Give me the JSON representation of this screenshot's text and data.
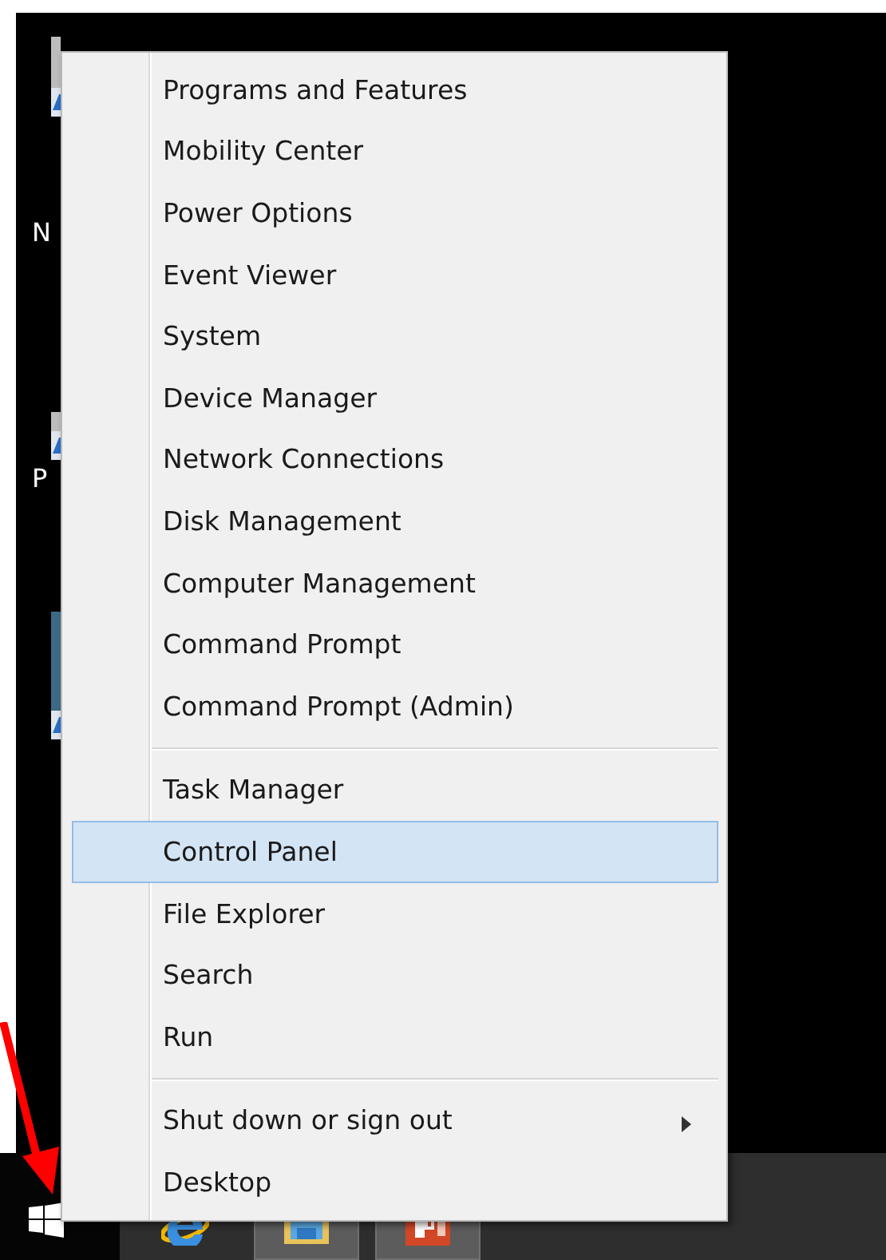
{
  "desktop_icons": [
    {
      "kind": "file"
    },
    {
      "label": "N"
    },
    {
      "kind": "file",
      "label": "P"
    },
    {
      "kind": "file"
    }
  ],
  "menu": {
    "groups": [
      [
        {
          "label": "Programs and Features",
          "selected": false
        },
        {
          "label": "Mobility Center",
          "selected": false
        },
        {
          "label": "Power Options",
          "selected": false
        },
        {
          "label": "Event Viewer",
          "selected": false
        },
        {
          "label": "System",
          "selected": false
        },
        {
          "label": "Device Manager",
          "selected": false
        },
        {
          "label": "Network Connections",
          "selected": false
        },
        {
          "label": "Disk Management",
          "selected": false
        },
        {
          "label": "Computer Management",
          "selected": false
        },
        {
          "label": "Command Prompt",
          "selected": false
        },
        {
          "label": "Command Prompt (Admin)",
          "selected": false
        }
      ],
      [
        {
          "label": "Task Manager",
          "selected": false
        },
        {
          "label": "Control Panel",
          "selected": true
        },
        {
          "label": "File Explorer",
          "selected": false
        },
        {
          "label": "Search",
          "selected": false
        },
        {
          "label": "Run",
          "selected": false
        }
      ],
      [
        {
          "label": "Shut down or sign out",
          "selected": false,
          "kind": "submenu"
        },
        {
          "label": "Desktop",
          "selected": false,
          "kind": "plain"
        }
      ]
    ]
  },
  "taskbar": {
    "apps": [
      {
        "kind": "browser",
        "running": false
      },
      {
        "kind": "folder",
        "running": true
      },
      {
        "kind": "slides",
        "running": true
      }
    ]
  }
}
